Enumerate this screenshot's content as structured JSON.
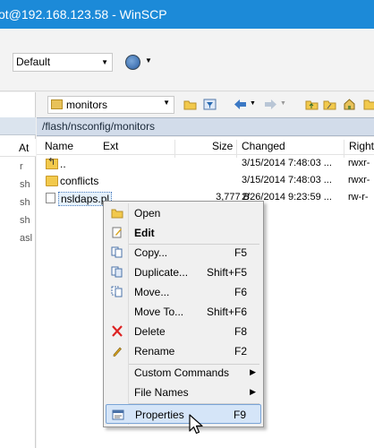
{
  "window": {
    "title": "ot@192.168.123.58 - WinSCP"
  },
  "toolbar": {
    "session_preset": "Default"
  },
  "left_panel": {
    "column_header": "At",
    "rows": [
      "r",
      "sh",
      "sh",
      "sh",
      "asl"
    ]
  },
  "remote": {
    "dir_combo": "monitors",
    "path": "/flash/nsconfig/monitors",
    "columns": {
      "name": "Name",
      "ext": "Ext",
      "size": "Size",
      "changed": "Changed",
      "rights": "Right"
    },
    "rows": [
      {
        "icon": "parent-dir-icon",
        "name": "..",
        "size": "",
        "changed": "3/15/2014 7:48:03 ...",
        "rights": "rwxr-"
      },
      {
        "icon": "folder-icon",
        "name": "conflicts",
        "size": "",
        "changed": "3/15/2014 7:48:03 ...",
        "rights": "rwxr-"
      },
      {
        "icon": "file-icon",
        "name": "nsldaps.pl",
        "size": "3,777 B",
        "changed": "2/26/2014 9:23:59 ...",
        "rights": "rw-r-"
      }
    ]
  },
  "context_menu": {
    "items": [
      {
        "label": "Open",
        "shortcut": "",
        "icon": "open-icon"
      },
      {
        "label": "Edit",
        "shortcut": "",
        "icon": "edit-icon"
      },
      {
        "label": "Copy...",
        "shortcut": "F5",
        "icon": "copy-icon"
      },
      {
        "label": "Duplicate...",
        "shortcut": "Shift+F5",
        "icon": "duplicate-icon"
      },
      {
        "label": "Move...",
        "shortcut": "F6",
        "icon": "move-icon"
      },
      {
        "label": "Move To...",
        "shortcut": "Shift+F6",
        "icon": ""
      },
      {
        "label": "Delete",
        "shortcut": "F8",
        "icon": "delete-icon"
      },
      {
        "label": "Rename",
        "shortcut": "F2",
        "icon": "rename-icon"
      },
      {
        "label": "Custom Commands",
        "shortcut": "",
        "icon": ""
      },
      {
        "label": "File Names",
        "shortcut": "",
        "icon": ""
      },
      {
        "label": "Properties",
        "shortcut": "F9",
        "icon": "properties-icon"
      }
    ]
  },
  "colors": {
    "titlebar": "#1c8ad8",
    "highlight": "#d5e5f8",
    "pathbar": "#d2dcea"
  }
}
